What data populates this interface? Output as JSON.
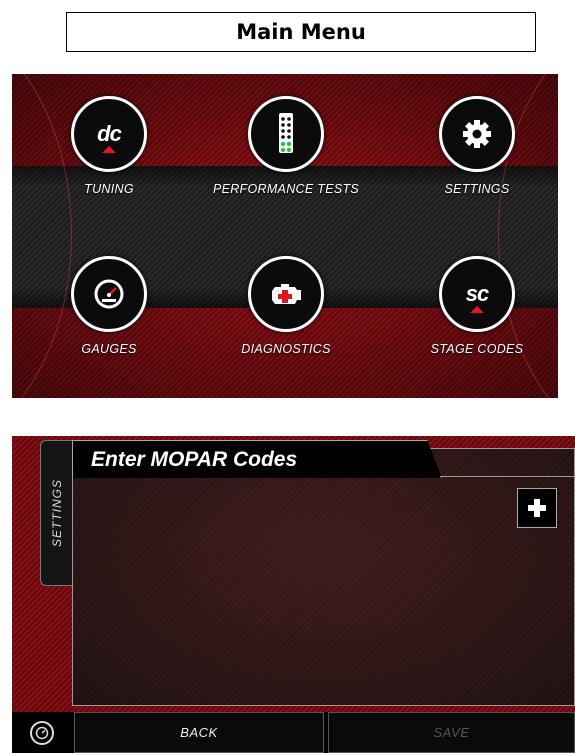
{
  "header": {
    "title": "Main Menu"
  },
  "main_menu": {
    "items": [
      {
        "label": "TUNING",
        "icon": "dc-logo-icon",
        "logo_text": "dc"
      },
      {
        "label": "PERFORMANCE TESTS",
        "icon": "drag-tree-icon"
      },
      {
        "label": "SETTINGS",
        "icon": "gear-icon"
      },
      {
        "label": "GAUGES",
        "icon": "speedometer-icon"
      },
      {
        "label": "DIAGNOSTICS",
        "icon": "engine-icon"
      },
      {
        "label": "STAGE CODES",
        "icon": "sc-logo-icon",
        "logo_text": "sc"
      }
    ]
  },
  "codes_screen": {
    "title": "Enter MOPAR Codes",
    "side_tab": "SETTINGS",
    "add_button_icon": "plus-icon",
    "back_label": "BACK",
    "save_label": "SAVE",
    "gauge_icon": "gauge-icon"
  },
  "colors": {
    "accent_red": "#e0161f",
    "panel_red": "#a8141b",
    "dark": "#0b0b0b"
  }
}
